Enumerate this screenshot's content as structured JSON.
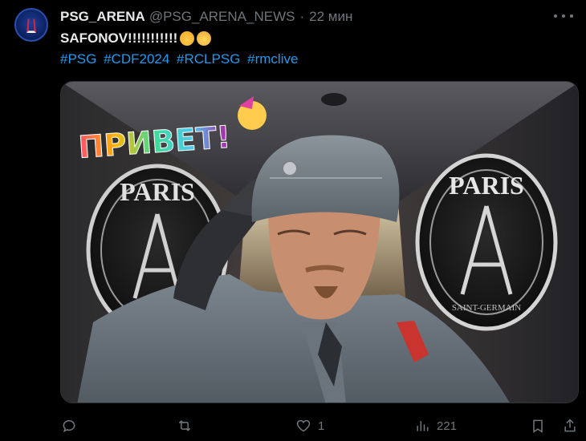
{
  "tweet": {
    "author_name": "PSG_ARENA",
    "author_handle": "@PSG_ARENA_NEWS",
    "separator": "·",
    "time": "22 мин",
    "text": "SAFONOV!!!!!!!!!!!",
    "emoji_icons": [
      "exploding-head-emoji",
      "saluting-face-emoji"
    ],
    "hashtags": [
      "#PSG",
      "#CDF2024",
      "#RCLPSG",
      "#rmclive"
    ],
    "media": {
      "sticker_text": "ПРИВЕТ!",
      "left_emblem_text": "PARIS",
      "right_emblem_text": "PARIS",
      "right_emblem_subtext": "SAINT-GERMAIN"
    }
  },
  "actions": {
    "reply_count": "",
    "retweet_count": "",
    "like_count": "1",
    "views_count": "221"
  },
  "colors": {
    "background": "#000000",
    "text": "#e7e9ea",
    "muted": "#71767b",
    "link": "#1d9bf0"
  }
}
